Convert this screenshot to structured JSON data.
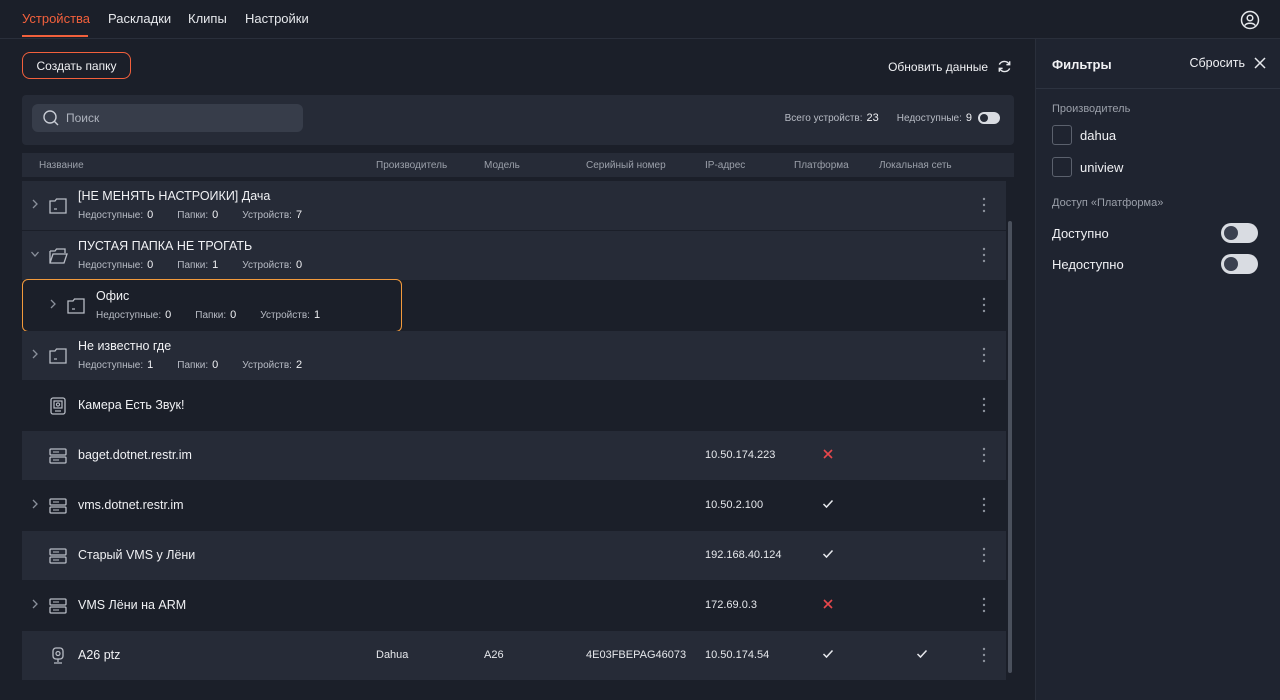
{
  "nav": {
    "tabs": [
      {
        "label": "Устройства",
        "active": true
      },
      {
        "label": "Раскладки"
      },
      {
        "label": "Клипы"
      },
      {
        "label": "Настройки"
      }
    ],
    "user_icon": "user-circle-icon",
    "accent": "#f2603c"
  },
  "toolbar": {
    "create_folder": "Создать папку",
    "refresh": "Обновить данные"
  },
  "search": {
    "placeholder": "Поиск",
    "total_label": "Всего устройств:",
    "total_value": "23",
    "unavailable_label": "Недоступные:",
    "unavailable_value": "9"
  },
  "table": {
    "columns": [
      "Название",
      "Производитель",
      "Модель",
      "Серийный номер",
      "IP-адрес",
      "Платформа",
      "Локальная сеть"
    ],
    "meta_labels": {
      "unavailable": "Недоступные:",
      "folders": "Папки:",
      "devices": "Устройств:"
    },
    "rows": [
      {
        "type": "folder",
        "name": "[НЕ МЕНЯТЬ НАСТРОИКИ] Дача",
        "unavailable": "0",
        "folders": "0",
        "devices": "7",
        "expanded": false
      },
      {
        "type": "folder",
        "name": "ПУСТАЯ ПАПКА НЕ ТРОГАТЬ",
        "unavailable": "0",
        "folders": "1",
        "devices": "0",
        "expanded": true
      },
      {
        "type": "folder",
        "name": "Офис",
        "unavailable": "0",
        "folders": "0",
        "devices": "1",
        "expanded": false,
        "nested": true
      },
      {
        "type": "folder",
        "name": "Не известно где",
        "unavailable": "1",
        "folders": "0",
        "devices": "2",
        "expanded": false
      },
      {
        "type": "camera",
        "name": "Камера Есть Звук!"
      },
      {
        "type": "server",
        "name": "baget.dotnet.restr.im",
        "ip": "10.50.174.223",
        "platform": "cross"
      },
      {
        "type": "server",
        "name": "vms.dotnet.restr.im",
        "ip": "10.50.2.100",
        "platform": "check",
        "expandable": true
      },
      {
        "type": "server",
        "name": "Старый VMS у Лёни",
        "ip": "192.168.40.124",
        "platform": "check"
      },
      {
        "type": "server",
        "name": "VMS Лёни на ARM",
        "ip": "172.69.0.3",
        "platform": "cross",
        "expandable": true
      },
      {
        "type": "webcam",
        "name": "A26 ptz",
        "vendor": "Dahua",
        "model": "A26",
        "serial": "4E03FBEPAG46073",
        "ip": "10.50.174.54",
        "platform": "check",
        "lan": "check"
      }
    ]
  },
  "filters": {
    "title": "Фильтры",
    "reset": "Сбросить",
    "vendor_section": "Производитель",
    "vendors": [
      "dahua",
      "uniview"
    ],
    "platform_section": "Доступ «Платформа»",
    "access": [
      "Доступно",
      "Недоступно"
    ]
  }
}
